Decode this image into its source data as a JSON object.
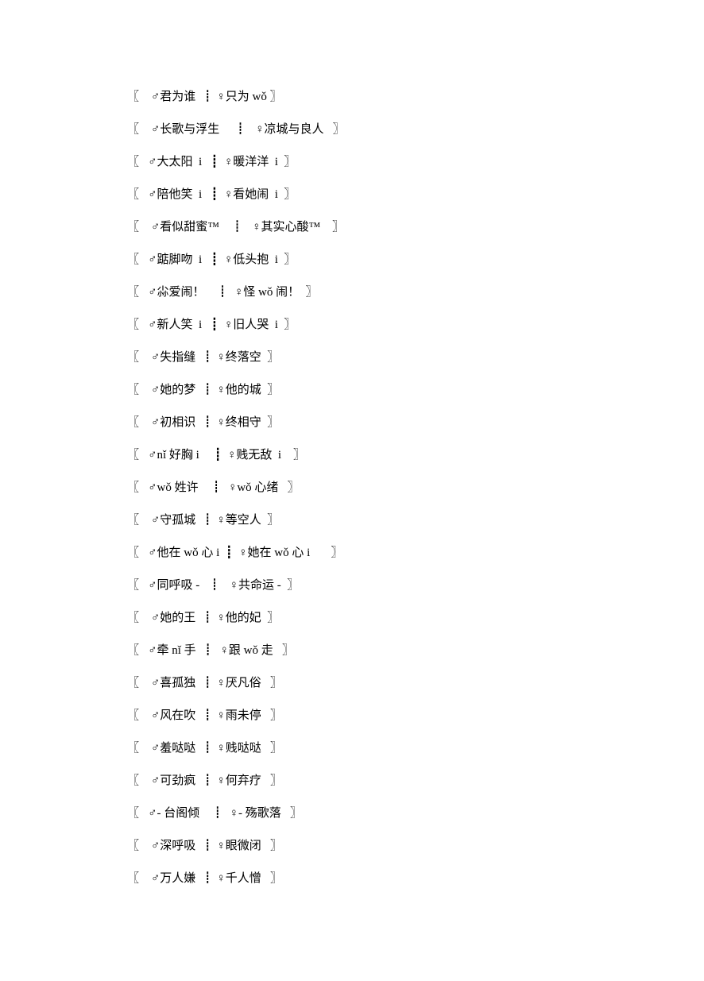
{
  "lines": [
    "〖    ♂君为谁  ┋ ♀只为 wǒ 〗",
    "〖    ♂长歌与浮生     ┋   ♀凉城与良人   〗",
    "〖   ♂大太阳  i   ┋  ♀暖洋洋  i  〗",
    "〖   ♂陪他笑  i   ┋  ♀看她闹  i  〗",
    "〖    ♂看似甜蜜™    ┋   ♀其实心酸™    〗",
    "〖   ♂踮脚吻  i   ┋  ♀低头抱  i  〗",
    "〖   ♂尛爱闹！    ┋  ♀怪 wǒ 闹！  〗",
    "〖   ♂新人笑  i   ┋  ♀旧人哭  i  〗",
    "〖    ♂失指缝  ┋ ♀终落空  〗",
    "〖    ♂她的梦  ┋ ♀他的城  〗",
    "〖    ♂初相识  ┋ ♀终相守  〗",
    "〖   ♂nǐ 好胸 i     ┋  ♀贱无敌  i    〗",
    "〖   ♂wǒ 姓许    ┋  ♀wǒ 心绪   〗",
    "〖    ♂守孤城  ┋ ♀等空人  〗",
    "〖   ♂他在 wǒ 心 i  ┋  ♀她在 wǒ 心 i       〗",
    "〖   ♂同呼吸 -   ┋   ♀共命运 -  〗",
    "〖    ♂她的王  ┋ ♀他的妃  〗",
    "〖   ♂牵 nǐ 手  ┋  ♀跟 wǒ 走   〗",
    "〖    ♂喜孤独  ┋ ♀厌凡俗   〗",
    "〖    ♂风在吹  ┋ ♀雨未停   〗",
    "〖    ♂羞哒哒  ┋ ♀贱哒哒   〗",
    "〖    ♂可劲疯  ┋ ♀何弃疗   〗",
    "〖   ♂- 台阁倾    ┋  ♀- 殇歌落   〗",
    "〖    ♂深呼吸  ┋ ♀眼微闭   〗",
    "〖    ♂万人嫌  ┋ ♀千人憎   〗"
  ]
}
